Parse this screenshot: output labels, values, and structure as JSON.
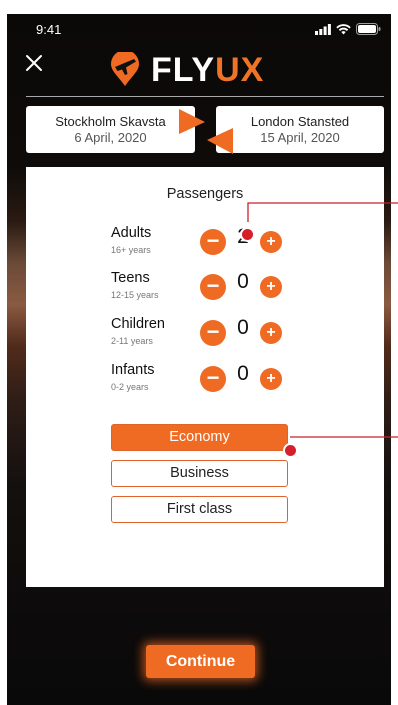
{
  "status": {
    "time": "9:41"
  },
  "brand": {
    "part1": "FLY",
    "part2": "UX",
    "accent": "#ef6a22"
  },
  "route": {
    "from": {
      "city": "Stockholm Skavsta",
      "date": "6 April, 2020"
    },
    "to": {
      "city": "London Stansted",
      "date": "15 April, 2020"
    }
  },
  "passengers": {
    "title": "Passengers",
    "rows": [
      {
        "label": "Adults",
        "sub": "16+ years",
        "value": "2"
      },
      {
        "label": "Teens",
        "sub": "12-15 years",
        "value": "0"
      },
      {
        "label": "Children",
        "sub": "2-11 years",
        "value": "0"
      },
      {
        "label": "Infants",
        "sub": "0-2 years",
        "value": "0"
      }
    ],
    "minus": "−",
    "plus": "+"
  },
  "classes": {
    "options": [
      "Economy",
      "Business",
      "First class"
    ],
    "selected": "Economy"
  },
  "continue_label": "Continue",
  "icons": {
    "close": "close-icon",
    "logo": "plane-pin-icon",
    "swap": "swap-arrows-icon"
  }
}
